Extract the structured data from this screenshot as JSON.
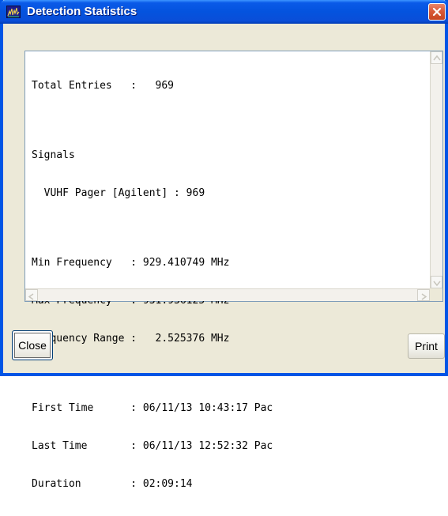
{
  "window": {
    "title": "Detection Statistics",
    "icon": "spectrum-app-icon",
    "close_icon": "close-icon"
  },
  "report": {
    "lines": [
      "Total Entries   :   969",
      "",
      "Signals",
      "  VUHF Pager [Agilent] : 969",
      "",
      "Min Frequency   : 929.410749 MHz",
      "Max Frequency   : 931.936125 MHz",
      "Frequency Range :   2.525376 MHz",
      "",
      "First Time      : 06/11/13 10:43:17 Pac",
      "Last Time       : 06/11/13 12:52:32 Pac",
      "Duration        : 02:09:14"
    ]
  },
  "buttons": {
    "close_label": "Close",
    "print_label": "Print"
  }
}
